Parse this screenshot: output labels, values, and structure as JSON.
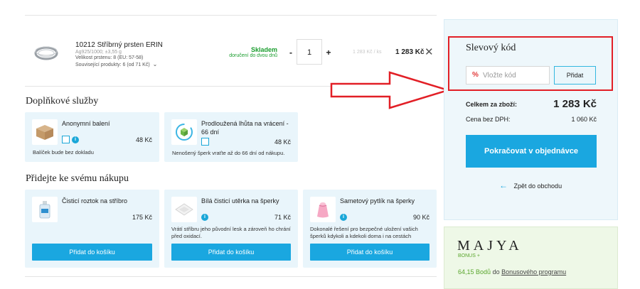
{
  "product": {
    "title": "10212 Stříbrný prsten ERIN",
    "meta1": "Ag925/1000; ±3,55 g",
    "meta2": "Velikost prstenu: 8 (EU: 57-58)",
    "meta3": "Související produkty: 6 (od 71 Kč)",
    "stock": "Skladem",
    "delivery": "doručení do dvou dnů",
    "qty_minus": "-",
    "qty": "1",
    "qty_plus": "+",
    "unit_price": "1 283 Kč / ks",
    "total_price": "1 283 Kč",
    "remove": "✕"
  },
  "services": {
    "title": "Doplňkové služby",
    "items": [
      {
        "title": "Anonymní balení",
        "price": "48 Kč",
        "desc": "Balíček bude bez dokladu",
        "icon": "package-icon"
      },
      {
        "title": "Prodloužená lhůta na vrácení - 66 dní",
        "price": "48 Kč",
        "desc": "Nenošený šperk vraťte až do 66 dní od nákupu.",
        "icon": "return-box-icon"
      }
    ]
  },
  "addons": {
    "title": "Přidejte ke svému nákupu",
    "button_label": "Přidat do košíku",
    "items": [
      {
        "title": "Čisticí roztok na stříbro",
        "price": "175 Kč",
        "desc": "",
        "icon": "bottle-icon"
      },
      {
        "title": "Bílá čisticí utěrka na šperky",
        "price": "71 Kč",
        "desc": "Vrátí stříbru jeho původní lesk a zároveň ho chrání před oxidací.",
        "icon": "cloth-icon"
      },
      {
        "title": "Sametový pytlík na šperky",
        "price": "90 Kč",
        "desc": "Dokonalé řešení pro bezpečné uložení vašich šperků kdykoli a kdekoli doma i na cestách",
        "icon": "pouch-icon"
      }
    ]
  },
  "sidebar": {
    "discount_title": "Slevový kód",
    "discount_placeholder": "Vložte kód",
    "discount_button": "Přidat",
    "total_label": "Celkem za zboží:",
    "total_value": "1 283 Kč",
    "net_label": "Cena bez DPH:",
    "net_value": "1 060 Kč",
    "continue_button": "Pokračovat v objednávce",
    "back_link": "Zpět do obchodu"
  },
  "bonus": {
    "brand": "MAJYA",
    "program": "BONUS +",
    "points": "64,15 Bodů",
    "text_mid": "do",
    "link": "Bonusového programu"
  },
  "colors": {
    "accent": "#1aa7e0",
    "stock_green": "#1a9d2e",
    "highlight_red": "#e21f26"
  }
}
